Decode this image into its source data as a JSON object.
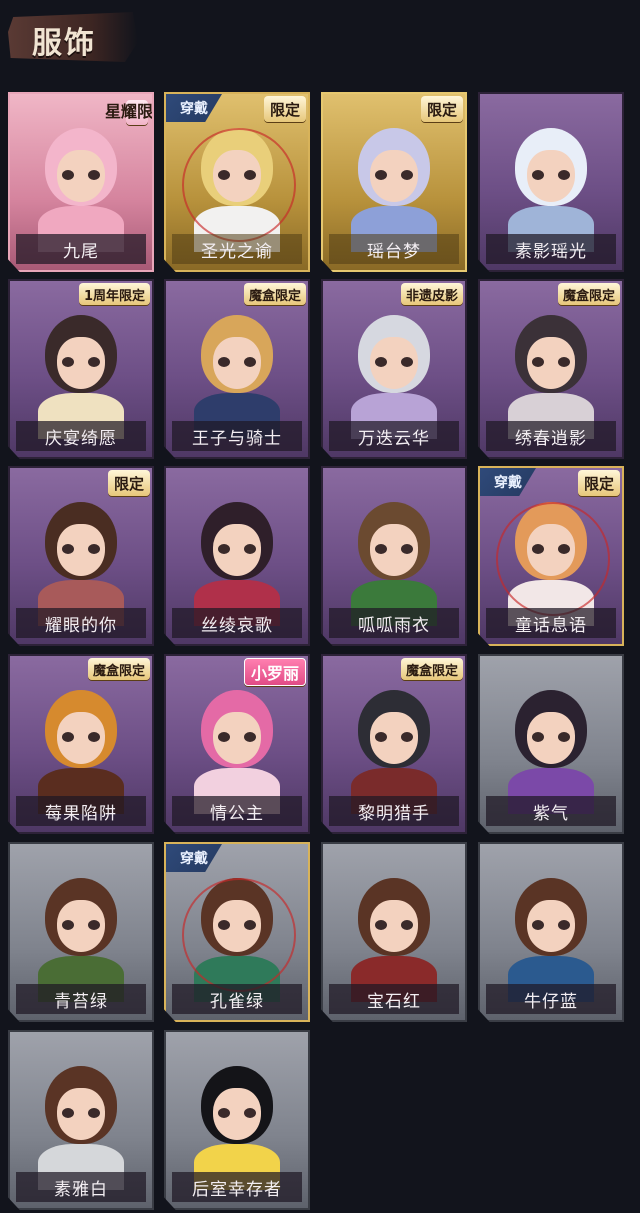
{
  "page": {
    "title": "服饰"
  },
  "cards": [
    {
      "name": "九尾",
      "tag": "星耀限定",
      "equipped": false,
      "frame": "pink",
      "hair": "#f3b5cb",
      "outfit": "#f0a8c0"
    },
    {
      "name": "圣光之谕",
      "tag": "限定",
      "equipped": true,
      "wear_label": "穿戴",
      "frame": "gold",
      "hair": "#e9cf7a",
      "outfit": "#f2f1f0"
    },
    {
      "name": "瑶台梦",
      "tag": "限定",
      "equipped": false,
      "frame": "gold",
      "hair": "#c8c8e8",
      "outfit": "#8da0d8"
    },
    {
      "name": "素影瑶光",
      "tag": "",
      "equipped": false,
      "frame": "purple",
      "hair": "#e8eef8",
      "outfit": "#9fb4d8"
    },
    {
      "name": "庆宴绮愿",
      "tag": "1周年限定",
      "equipped": false,
      "frame": "purple",
      "hair": "#3a2a2a",
      "outfit": "#efe1c0"
    },
    {
      "name": "王子与骑士",
      "tag": "魔盒限定",
      "equipped": false,
      "frame": "purple",
      "hair": "#d8a65a",
      "outfit": "#2e3d6b"
    },
    {
      "name": "万迭云华",
      "tag": "非遗皮影",
      "equipped": false,
      "frame": "purple",
      "hair": "#d6d8e0",
      "outfit": "#b8a3d6"
    },
    {
      "name": "绣春逍影",
      "tag": "魔盒限定",
      "equipped": false,
      "frame": "purple",
      "hair": "#3b3138",
      "outfit": "#d8d0d6"
    },
    {
      "name": "耀眼的你",
      "tag": "限定",
      "equipped": false,
      "frame": "purple",
      "hair": "#4a2d22",
      "outfit": "#a85a5a"
    },
    {
      "name": "丝绫哀歌",
      "tag": "",
      "equipped": false,
      "frame": "purple",
      "hair": "#2f1f2a",
      "outfit": "#b0304a"
    },
    {
      "name": "呱呱雨衣",
      "tag": "",
      "equipped": false,
      "frame": "purple",
      "hair": "#6b4a30",
      "outfit": "#3b7a3b"
    },
    {
      "name": "童话息语",
      "tag": "限定",
      "equipped": true,
      "wear_label": "穿戴",
      "frame": "purple",
      "hair": "#e39a5a",
      "outfit": "#f2e7e7"
    },
    {
      "name": "莓果陷阱",
      "tag": "魔盒限定",
      "equipped": false,
      "frame": "purple",
      "hair": "#d68a2e",
      "outfit": "#5a2d1f"
    },
    {
      "name": "情公主",
      "tag": "小罗丽",
      "equipped": false,
      "frame": "purple",
      "hair": "#e46aa6",
      "outfit": "#f2d0df"
    },
    {
      "name": "黎明猎手",
      "tag": "魔盒限定",
      "equipped": false,
      "frame": "purple",
      "hair": "#2d2d35",
      "outfit": "#7a2b2b"
    },
    {
      "name": "紫气",
      "tag": "",
      "equipped": false,
      "frame": "grey",
      "hair": "#2b2230",
      "outfit": "#7b49a8"
    },
    {
      "name": "青苔绿",
      "tag": "",
      "equipped": false,
      "frame": "grey",
      "hair": "#5a3425",
      "outfit": "#4a6d35"
    },
    {
      "name": "孔雀绿",
      "tag": "",
      "equipped": true,
      "wear_label": "穿戴",
      "frame": "grey",
      "hair": "#5a3425",
      "outfit": "#2f7a5a"
    },
    {
      "name": "宝石红",
      "tag": "",
      "equipped": false,
      "frame": "grey",
      "hair": "#5a3425",
      "outfit": "#8a2a2a"
    },
    {
      "name": "牛仔蓝",
      "tag": "",
      "equipped": false,
      "frame": "grey",
      "hair": "#5a3425",
      "outfit": "#2b5a8f"
    },
    {
      "name": "素雅白",
      "tag": "",
      "equipped": false,
      "frame": "grey",
      "hair": "#5a3425",
      "outfit": "#d5d7da"
    },
    {
      "name": "后室幸存者",
      "tag": "",
      "equipped": false,
      "frame": "grey",
      "hair": "#141418",
      "outfit": "#f2d34a"
    }
  ]
}
